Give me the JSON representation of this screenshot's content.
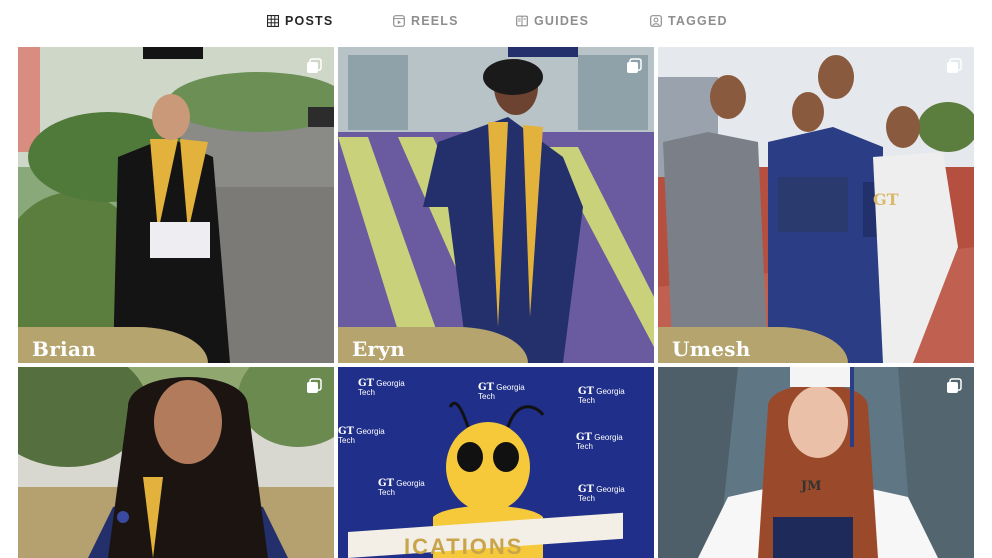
{
  "tabs": [
    {
      "label": "POSTS",
      "icon": "grid-icon",
      "active": true
    },
    {
      "label": "REELS",
      "icon": "reels-icon",
      "active": false
    },
    {
      "label": "GUIDES",
      "icon": "guides-icon",
      "active": false
    },
    {
      "label": "TAGGED",
      "icon": "tagged-icon",
      "active": false
    }
  ],
  "posts": [
    {
      "name": "Brian",
      "multi": true
    },
    {
      "name": "Eryn",
      "multi": true
    },
    {
      "name": "Umesh",
      "multi": true
    },
    {
      "name": "",
      "multi": true
    },
    {
      "name": "",
      "multi": false
    },
    {
      "name": "",
      "multi": true
    }
  ],
  "sponsor_wall": {
    "logo": "GT",
    "line1": "Georgia",
    "line2": "Tech"
  },
  "sign_text": "ICATIONS",
  "cap_letters": "JM",
  "book_letters": "GT",
  "colors": {
    "banner": "#b5a46e",
    "active_tab": "#262626",
    "inactive_tab": "#8e8e8e",
    "gown_navy": "#23306b",
    "stole_gold": "#e3b23c"
  }
}
